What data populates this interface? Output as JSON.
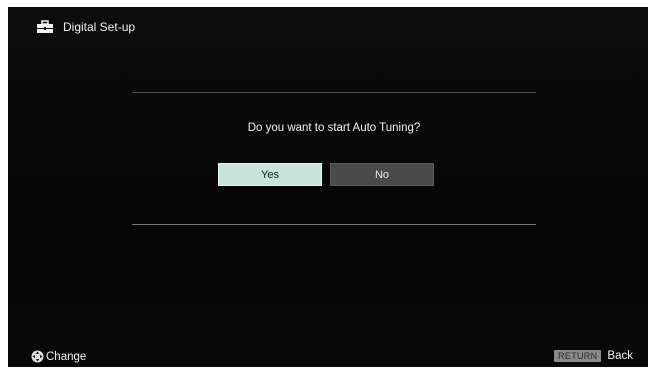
{
  "header": {
    "title": "Digital Set-up",
    "icon": "toolbox-icon"
  },
  "dialog": {
    "question": "Do you want to start Auto Tuning?",
    "yes_label": "Yes",
    "no_label": "No",
    "selected": "Yes"
  },
  "footer": {
    "change_label": "Change",
    "change_icon": "dpad-icon",
    "return_key": "RETURN",
    "back_label": "Back"
  },
  "colors": {
    "background": "#0a0a0a",
    "selected_button": "#c7e3dc",
    "unselected_button": "#4a4a4a",
    "text": "#f0f0f0"
  }
}
